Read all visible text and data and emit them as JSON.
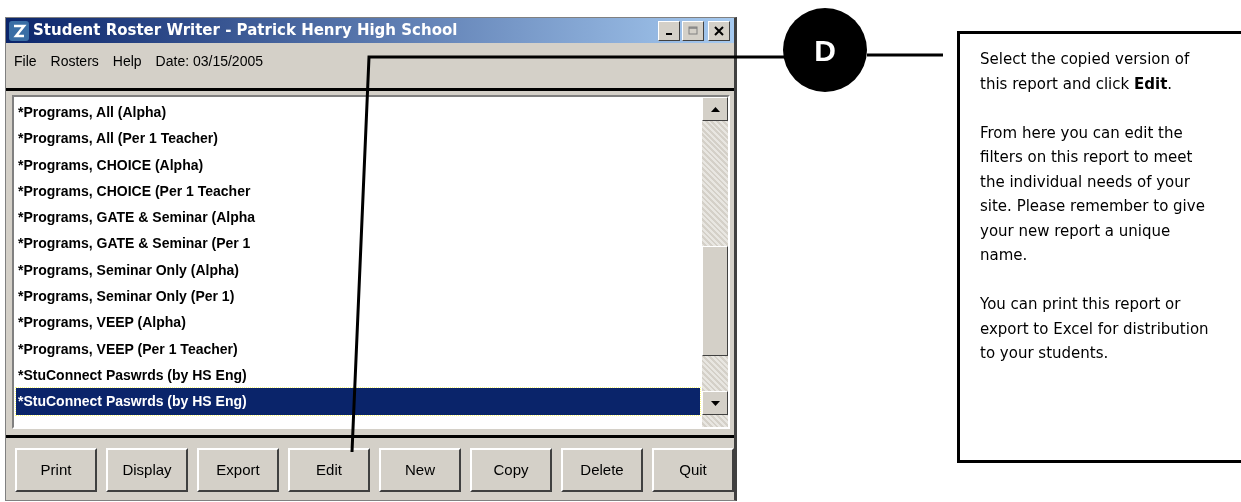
{
  "window": {
    "title": "Student Roster Writer - Patrick Henry High School",
    "controls": [
      {
        "kind": "minimize",
        "disabled": false
      },
      {
        "kind": "maximize",
        "disabled": true
      },
      {
        "kind": "close",
        "disabled": false
      }
    ]
  },
  "menu": [
    "File",
    "Rosters",
    "Help"
  ],
  "date": "Date: 03/15/2005",
  "reports": [
    {
      "label": "*Programs, All (Alpha)",
      "selected": false
    },
    {
      "label": "*Programs, All (Per 1 Teacher)",
      "selected": false
    },
    {
      "label": "*Programs, CHOICE (Alpha)",
      "selected": false
    },
    {
      "label": "*Programs, CHOICE (Per 1 Teacher",
      "selected": false
    },
    {
      "label": "*Programs, GATE & Seminar (Alpha",
      "selected": false
    },
    {
      "label": "*Programs, GATE & Seminar (Per 1",
      "selected": false
    },
    {
      "label": "*Programs, Seminar Only (Alpha)",
      "selected": false
    },
    {
      "label": "*Programs, Seminar Only (Per 1)",
      "selected": false
    },
    {
      "label": "*Programs, VEEP (Alpha)",
      "selected": false
    },
    {
      "label": "*Programs, VEEP (Per 1 Teacher)",
      "selected": false
    },
    {
      "label": "*StuConnect Paswrds (by HS Eng)",
      "selected": false
    },
    {
      "label": "*StuConnect Paswrds (by HS Eng)",
      "selected": true
    }
  ],
  "buttons": [
    {
      "label": "Print"
    },
    {
      "label": "Display"
    },
    {
      "label": "Export"
    },
    {
      "label": "Edit"
    },
    {
      "label": "New"
    },
    {
      "label": "Copy"
    },
    {
      "label": "Delete"
    },
    {
      "label": "Quit"
    }
  ],
  "callout": {
    "marker": "D",
    "paragraphs": [
      "Select the copied version of this report and click **Edit**.",
      "From here you can edit the filters on this report to meet the individual needs of your site. Please remember to give your new report a unique name.",
      "You can print this report or export to Excel for distribution to your students."
    ]
  }
}
